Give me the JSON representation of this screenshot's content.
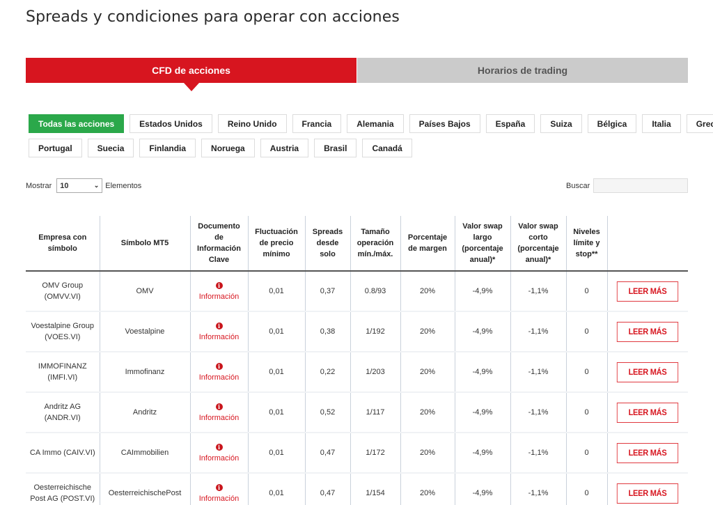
{
  "page": {
    "title": "Spreads y condiciones para operar con acciones"
  },
  "tabs": [
    {
      "label": "CFD de acciones",
      "active": true
    },
    {
      "label": "Horarios de trading",
      "active": false
    }
  ],
  "filters": {
    "row1": [
      "Todas las acciones",
      "Estados Unidos",
      "Reino Unido",
      "Francia",
      "Alemania",
      "Países Bajos",
      "España",
      "Suiza",
      "Bélgica",
      "Italia",
      "Grecia"
    ],
    "row2": [
      "Portugal",
      "Suecia",
      "Finlandia",
      "Noruega",
      "Austria",
      "Brasil",
      "Canadá"
    ],
    "active": "Todas las acciones"
  },
  "controls": {
    "show_label": "Mostrar",
    "show_value": "10",
    "elements_label": "Elementos",
    "search_label": "Buscar",
    "search_value": ""
  },
  "table": {
    "headers": [
      "Empresa con símbolo",
      "Símbolo MT5",
      "Documento de Información Clave",
      "Fluctuación de precio mínimo",
      "Spreads desde solo",
      "Tamaño operación mín./máx.",
      "Porcentaje de margen",
      "Valor swap largo (porcentaje anual)*",
      "Valor swap corto (porcentaje anual)*",
      "Niveles límite y stop**",
      ""
    ],
    "info_label": "Información",
    "read_more_label": "LEER MÁS",
    "rows": [
      {
        "company": "OMV Group (OMVV.VI)",
        "symbol": "OMV",
        "fluct": "0,01",
        "spread": "0,37",
        "size": "0.8/93",
        "margin": "20%",
        "swap_long": "-4,9%",
        "swap_short": "-1,1%",
        "levels": "0"
      },
      {
        "company": "Voestalpine Group (VOES.VI)",
        "symbol": "Voestalpine",
        "fluct": "0,01",
        "spread": "0,38",
        "size": "1/192",
        "margin": "20%",
        "swap_long": "-4,9%",
        "swap_short": "-1,1%",
        "levels": "0"
      },
      {
        "company": "IMMOFINANZ (IMFI.VI)",
        "symbol": "Immofinanz",
        "fluct": "0,01",
        "spread": "0,22",
        "size": "1/203",
        "margin": "20%",
        "swap_long": "-4,9%",
        "swap_short": "-1,1%",
        "levels": "0"
      },
      {
        "company": "Andritz AG (ANDR.VI)",
        "symbol": "Andritz",
        "fluct": "0,01",
        "spread": "0,52",
        "size": "1/117",
        "margin": "20%",
        "swap_long": "-4,9%",
        "swap_short": "-1,1%",
        "levels": "0"
      },
      {
        "company": "CA Immo (CAIV.VI)",
        "symbol": "CAImmobilien",
        "fluct": "0,01",
        "spread": "0,47",
        "size": "1/172",
        "margin": "20%",
        "swap_long": "-4,9%",
        "swap_short": "-1,1%",
        "levels": "0"
      },
      {
        "company": "Oesterreichische Post AG (POST.VI)",
        "symbol": "OesterreichischePost",
        "fluct": "0,01",
        "spread": "0,47",
        "size": "1/154",
        "margin": "20%",
        "swap_long": "-4,9%",
        "swap_short": "-1,1%",
        "levels": "0"
      }
    ]
  },
  "colors": {
    "brand_red": "#d7151f",
    "active_filter_green": "#2ba84a",
    "inactive_tab_gray": "#cbcbcb"
  }
}
